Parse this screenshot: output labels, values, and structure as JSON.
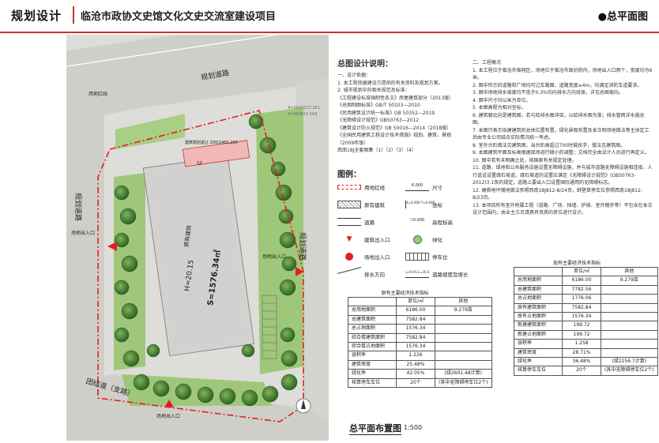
{
  "header": {
    "section": "规划设计",
    "project": "临沧市政协文史馆文化文史交流室建设项目",
    "sheet": "●总平面图"
  },
  "plan": {
    "road_top": "规划道路",
    "road_left": "规划道路",
    "road_right": "规划道路",
    "road_bottom": "团结道（支路）",
    "use_land": "用地红线",
    "entry_left": "场地出入口",
    "entry_right": "场地出入口",
    "entry_bottom": "场地出入口",
    "coord_a": "X=2642517.351",
    "coord_b": "Y=500815.564",
    "coord_c": "X=2642537.5",
    "old_bldg": "原有建筑",
    "new_bldg": "新建建筑",
    "dim_label": "建筑规划退让 200/1465.200",
    "bldg_title": "原有建筑",
    "bldg_h": "H=20.15",
    "bldg_s": "S=1576.34㎡",
    "floor_tag": "5F",
    "scale_tag": "比例",
    "compass": "N"
  },
  "notes_left": {
    "title": "总图设计说明：",
    "lines": [
      "一、设计依据：",
      "1. 本工程依据建设方提供的有关资料及规划方案。",
      "2. 城市规划中的相关规范及标准：",
      "《工程建设标准强制性条文》房屋建筑部分（2013版）",
      "《总图制图标准》GB/T 50103—2010",
      "《民用建筑设计统一标准》GB 50352—2019",
      "《无障碍设计规范》GB50763—2012",
      "《建筑设计防火规范》GB 50016—2014（2018版）",
      "《全国民用建筑工程设计技术措施》规划、建筑、景观（2009年版）",
      "西南18J全套图集（1）（2）（3）（4）"
    ]
  },
  "notes_right": {
    "lines": [
      "二、工程概况",
      "1. 本工程位于临沧市临翔区，场地位于临沧市政协院内，场地出入口两个，宽度均为6米。",
      "2. 图中所示的道路和广场均可过车路面，道路宽度≥4m，均满足消防车道要求。",
      "3. 图中场地排水坡度均不低于0.3%均向排水方向找坡，详见总图坡向。",
      "4. 图中尺寸均以米为单位。",
      "5. 本图高程为相对坐标。",
      "6. 建筑朝北向是建筑图，若与给排水图冲突，以给排水图为准；排水管网详水施总图。",
      "7. 本图只表示拟建建筑的总体位置布置，绿化景观布置及本次明场地做法等主体定工后由专业公司结合实际情况统一考虑。",
      "8. 室外台阶做法见建筑图，当台阶高超过700时做扶手，做法见建筑图。",
      "9. 本图建筑平面及标高根据现场进行微小的调整；文档完全由设计人员进行再定义。",
      "10. 图中若有未明确之处，按国家有关规定处理。",
      "11. 道路、绿地和公共服务设施设置无障碍设施，并与城市道路无障碍设施相连接，人行道设设置缘石坡道，缘石坡道的设置应满足《无障碍设计规范》(GB50763-2012)3.1条的规定，道路上要出入口设置国际通用的无障碍标志。",
      "12. 硬质地坪铺地做法参照西南18J812-8/24页，蚌壁草停车位参照西南18J812-8/23页。",
      "13. 本项目所有室外附属工程（道路、广场、挡墙、护坡、室外踏步等）不包含在本次设计范围内，由业主方另请具有资质的单位进行设计。"
    ]
  },
  "legend": {
    "title": "图例：",
    "items": [
      "用地红线",
      "尺寸",
      "原有建筑",
      "坐标",
      "道路",
      "高程标高",
      "建筑出入口",
      "绿化",
      "场地出入口",
      "停车位",
      "排水方向",
      "道路坡度及坡长"
    ],
    "dim_sample": "6.000",
    "coord_sample": "X=0.000 Y=0.000",
    "elev_sample": "▽0.000",
    "slope_sample": "i=0.5% L=35.0"
  },
  "table_left": {
    "title": "原有主要经济技术指标",
    "head": [
      "",
      "单位/㎡",
      "其他"
    ],
    "rows": [
      [
        "总用地面积",
        "6186.00",
        "9.279亩"
      ],
      [
        "总建筑面积",
        "7582.84",
        ""
      ],
      [
        "总占地面积",
        "1576.34",
        ""
      ],
      [
        "综合楼建筑面积",
        "7582.84",
        ""
      ],
      [
        "综合楼占地面积",
        "1576.34",
        ""
      ],
      [
        "容积率",
        "1.226",
        ""
      ],
      [
        "建筑密度",
        "25.48%",
        ""
      ],
      [
        "绿化率",
        "42.05%",
        "(绿2601.48计算)"
      ],
      [
        "核算停车车位",
        "20个",
        "(其中无障碍停车位2个)"
      ]
    ]
  },
  "table_right": {
    "title": "现有主要经济技术指标",
    "head": [
      "",
      "单位/㎡",
      "其他"
    ],
    "rows": [
      [
        "总用地面积",
        "6186.00",
        "9.279亩"
      ],
      [
        "总建筑面积",
        "7782.56",
        ""
      ],
      [
        "总占地面积",
        "1776.06",
        ""
      ],
      [
        "原有建筑面积",
        "7582.84",
        ""
      ],
      [
        "原有占地面积",
        "1576.34",
        ""
      ],
      [
        "新建建筑面积",
        "199.72",
        ""
      ],
      [
        "新建占地面积",
        "199.72",
        ""
      ],
      [
        "容积率",
        "1.258",
        ""
      ],
      [
        "建筑密度",
        "28.71%",
        ""
      ],
      [
        "绿化率",
        "36.48%",
        "(绿2256.7计算)"
      ],
      [
        "核算停车车位",
        "20个",
        "(其中无障碍停车位2个)"
      ]
    ]
  },
  "footer": {
    "plan_title": "总平面布置图",
    "scale": "1:500"
  },
  "colors": {
    "accent": "#c0392b",
    "green": "#4f8a3a",
    "tree": "#3d7a2e",
    "road": "#c9c9c4",
    "building": "#d8d8d8"
  }
}
